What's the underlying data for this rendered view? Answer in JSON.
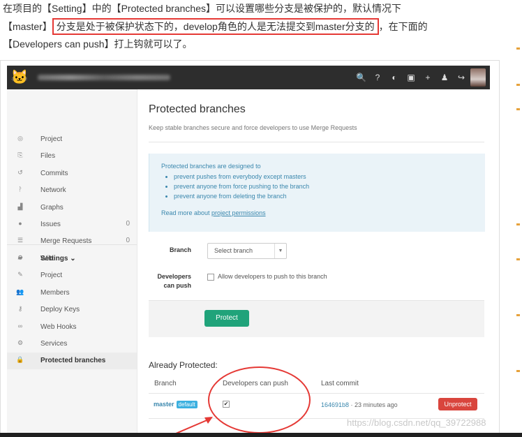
{
  "article": {
    "line1": "在项目的【Setting】中的【Protected branches】可以设置哪些分支是被保护的，默认情况下",
    "line2_prefix": "【master】",
    "line2_highlight": "分支是处于被保护状态下的，develop角色的人是无法提交到master分支的",
    "line2_suffix": "，在下面的",
    "line3": "【Developers can push】打上钩就可以了。"
  },
  "navbar": {
    "icons": [
      "search-icon",
      "help-icon",
      "explore-icon",
      "copy-icon",
      "plus-icon",
      "user-icon",
      "logout-icon"
    ],
    "icon_glyphs": [
      "🔍",
      "?",
      "◐",
      "▣",
      "+",
      "♟",
      "↪"
    ]
  },
  "sidebar": {
    "items": [
      {
        "icon": "dashboard-icon",
        "glyph": "◎",
        "label": "Project",
        "count": ""
      },
      {
        "icon": "files-icon",
        "glyph": "⎘",
        "label": "Files",
        "count": ""
      },
      {
        "icon": "commits-icon",
        "glyph": "↺",
        "label": "Commits",
        "count": ""
      },
      {
        "icon": "network-icon",
        "glyph": "ᚹ",
        "label": "Network",
        "count": ""
      },
      {
        "icon": "graphs-icon",
        "glyph": "▟",
        "label": "Graphs",
        "count": ""
      },
      {
        "icon": "issues-icon",
        "glyph": "●",
        "label": "Issues",
        "count": "0"
      },
      {
        "icon": "merge-requests-icon",
        "glyph": "☰",
        "label": "Merge Requests",
        "count": "0"
      },
      {
        "icon": "wiki-icon",
        "glyph": "▰",
        "label": "Wiki",
        "count": ""
      }
    ],
    "settings_items": [
      {
        "icon": "settings-icon",
        "glyph": "⚙",
        "label": "Settings ⌄"
      },
      {
        "icon": "edit-icon",
        "glyph": "✎",
        "label": "Project"
      },
      {
        "icon": "members-icon",
        "glyph": "👥",
        "label": "Members"
      },
      {
        "icon": "key-icon",
        "glyph": "⚷",
        "label": "Deploy Keys"
      },
      {
        "icon": "link-icon",
        "glyph": "∞",
        "label": "Web Hooks"
      },
      {
        "icon": "services-icon",
        "glyph": "⚙",
        "label": "Services"
      },
      {
        "icon": "lock-icon",
        "glyph": "🔒",
        "label": "Protected branches"
      }
    ]
  },
  "main": {
    "title": "Protected branches",
    "description": "Keep stable branches secure and force developers to use Merge Requests",
    "info": {
      "heading": "Protected branches are designed to",
      "bullets": [
        "prevent pushes from everybody except masters",
        "prevent anyone from force pushing to the branch",
        "prevent anyone from deleting the branch"
      ],
      "read_more_prefix": "Read more about ",
      "read_more_link": "project permissions"
    },
    "form": {
      "branch_label": "Branch",
      "branch_placeholder": "Select branch",
      "developers_label": "Developers can push",
      "developers_checkbox_label": "Allow developers to push to this branch",
      "protect_button": "Protect"
    },
    "already_protected": {
      "title": "Already Protected:",
      "columns": [
        "Branch",
        "Developers can push",
        "Last commit"
      ],
      "rows": [
        {
          "branch": "master",
          "badge": "default",
          "developers_can_push": true,
          "commit_sha": "164691b8",
          "commit_time": " · 23 minutes ago",
          "action": "Unprotect"
        }
      ]
    }
  },
  "watermark": "https://blog.csdn.net/qq_39722988",
  "colors": {
    "highlight_red": "#e53935",
    "protect_green": "#20a37a",
    "unprotect_red": "#d9453d",
    "link_blue": "#3a87ad",
    "info_bg": "#eaf3f8",
    "navbar_bg": "#2d2d2d"
  }
}
